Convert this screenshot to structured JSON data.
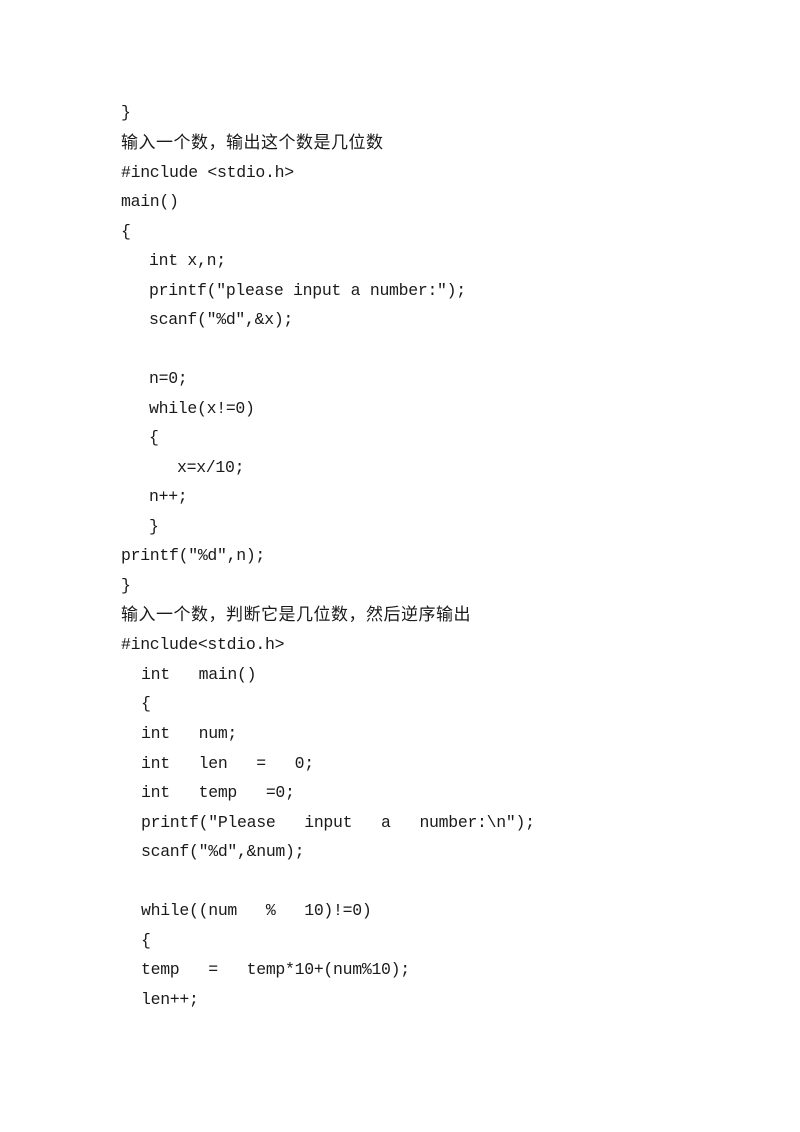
{
  "document": {
    "block1": {
      "closing_brace_prev": "}",
      "heading": "输入一个数，输出这个数是几位数",
      "lines": [
        "#include <stdio.h>",
        "main()",
        "{",
        "int x,n;",
        "printf(\"please input a number:\");",
        "scanf(\"%d\",&x);",
        "",
        "n=0;",
        "while(x!=0)",
        "{",
        "x=x/10;",
        "n++;",
        "}",
        "printf(\"%d\",n);",
        "}"
      ]
    },
    "block2": {
      "heading": "输入一个数，判断它是几位数，然后逆序输出",
      "lines": [
        "#include<stdio.h>",
        "int   main()",
        "{",
        "int   num;",
        "int   len   =   0;",
        "int   temp   =0;",
        "printf(\"Please   input   a   number:\\n\");",
        "scanf(\"%d\",&num);",
        "",
        "while((num   %   10)!=0)",
        "{",
        "temp   =   temp*10+(num%10);",
        "len++;"
      ]
    }
  }
}
